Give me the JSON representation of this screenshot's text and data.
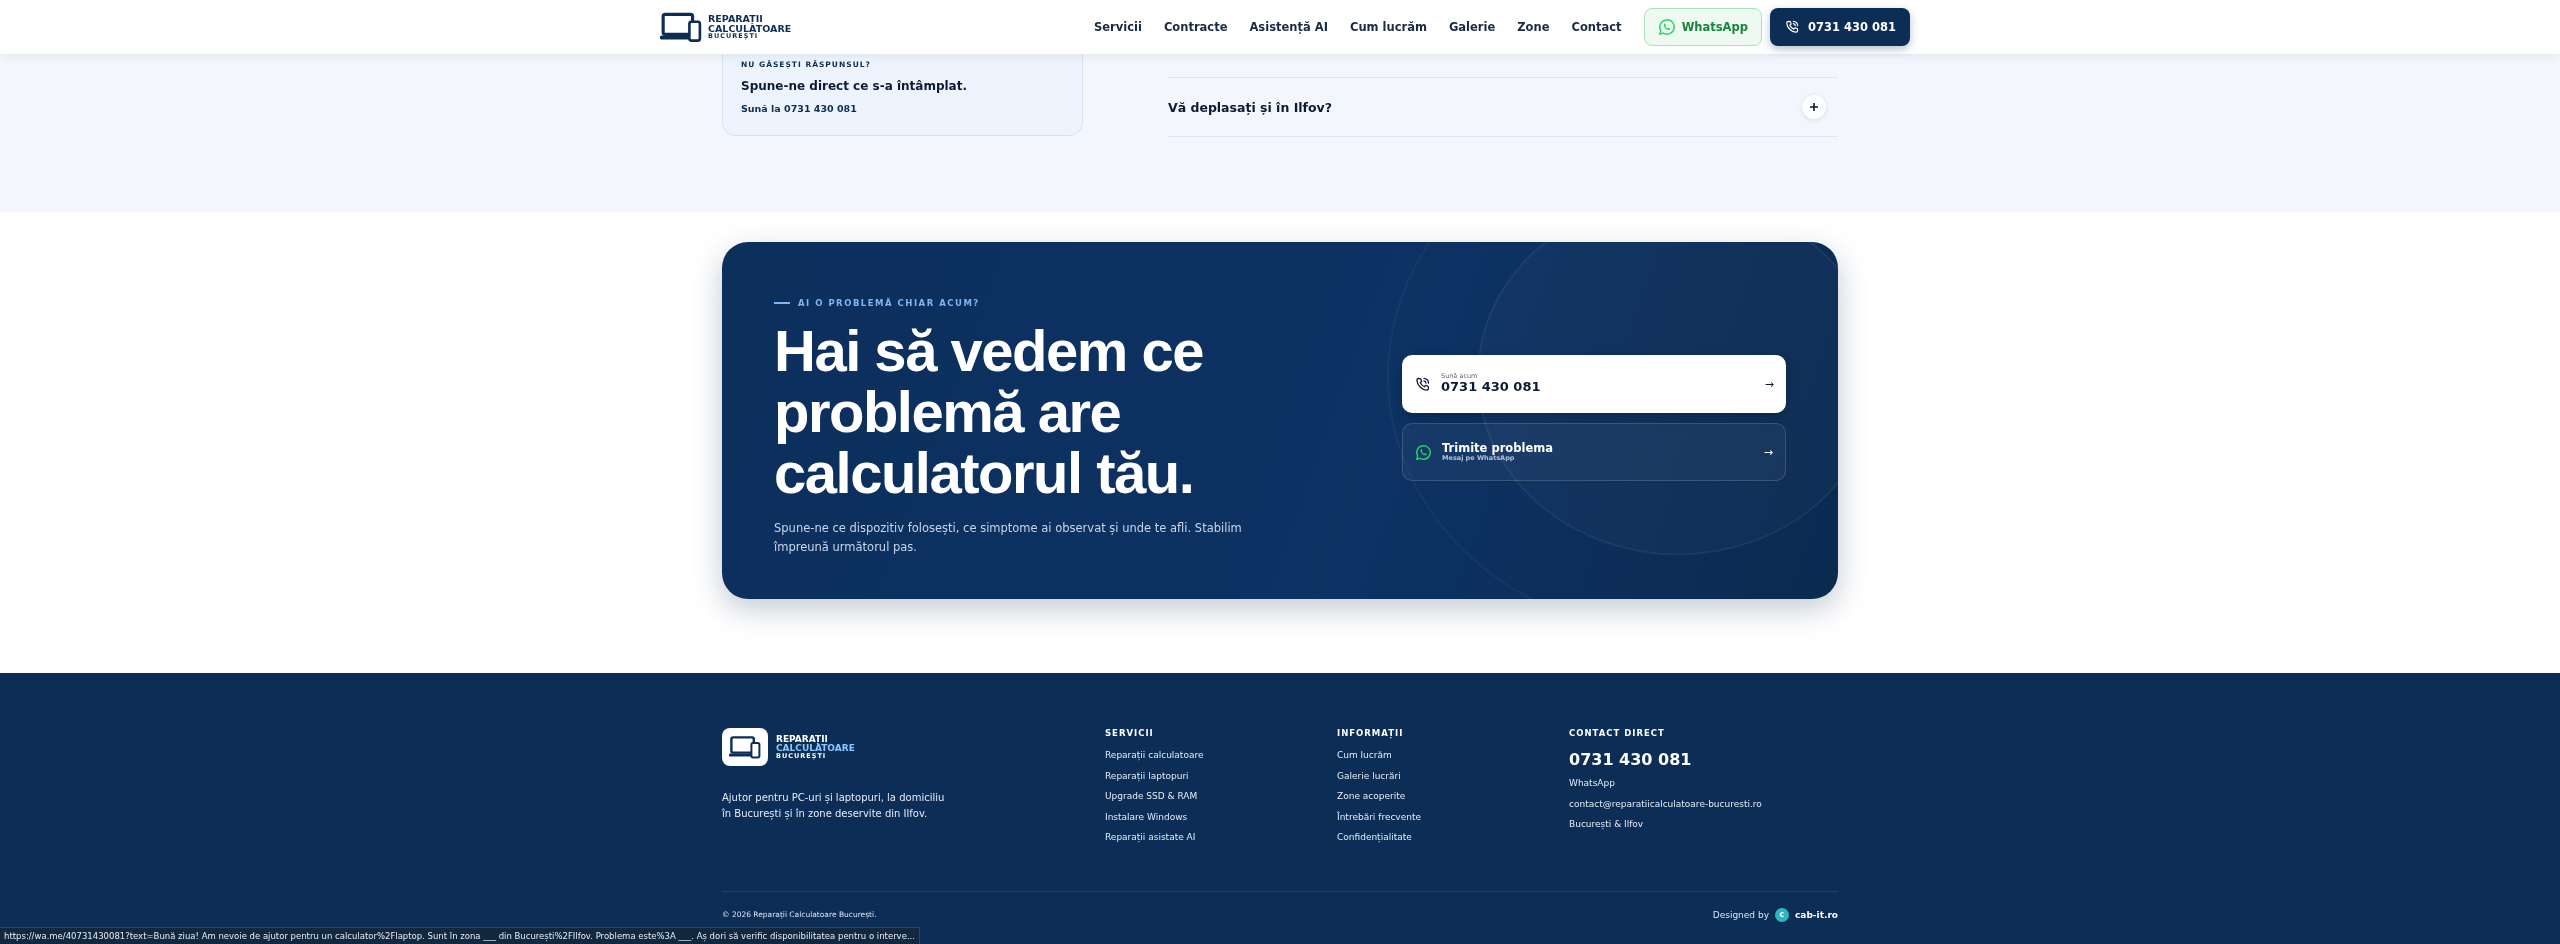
{
  "header": {
    "logo": {
      "line_1": "REPARAȚII",
      "line_2": "CALCULATOARE",
      "line_3": "BUCUREȘTI"
    },
    "nav": [
      {
        "label": "Servicii"
      },
      {
        "label": "Contracte"
      },
      {
        "label": "Asistență AI"
      },
      {
        "label": "Cum lucrăm"
      },
      {
        "label": "Galerie"
      },
      {
        "label": "Zone"
      },
      {
        "label": "Contact"
      }
    ],
    "whatsapp_button": "WhatsApp",
    "phone_button": "0731 430 081"
  },
  "help_card": {
    "eyebrow": "NU GĂSEȘTI RĂSPUNSUL?",
    "title": "Spune-ne direct ce s-a întâmplat.",
    "link": "Sună la 0731 430 081"
  },
  "faq": [
    {
      "question": "Vă deplasați și în Ilfov?",
      "expanded": false
    }
  ],
  "cta": {
    "eyebrow": "AI O PROBLEMĂ CHIAR ACUM?",
    "heading": "Hai să vedem ce\nproblemă are\ncalculatorul tău.",
    "text": "Spune-ne ce dispozitiv folosești, ce simptome ai observat și unde te afli. Stabilim împreună următorul pas.",
    "actions": [
      {
        "kind": "phone",
        "caption": "Sună acum",
        "title": "0731 430 081",
        "arrow": "→"
      },
      {
        "kind": "whatsapp",
        "title": "Trimite problema",
        "caption": "Mesaj pe WhatsApp",
        "arrow": "→"
      }
    ]
  },
  "footer": {
    "logo": {
      "line_1": "REPARAȚII",
      "line_2": "CALCULATOARE",
      "line_3": "BUCUREȘTI"
    },
    "about": "Ajutor pentru PC-uri și laptopuri, la domiciliu în București și în zone deservite din Ilfov.",
    "columns": [
      {
        "title": "SERVICII",
        "links": [
          "Reparații calculatoare",
          "Reparații laptopuri",
          "Upgrade SSD & RAM",
          "Instalare Windows",
          "Reparații asistate AI"
        ]
      },
      {
        "title": "INFORMAȚII",
        "links": [
          "Cum lucrăm",
          "Galerie lucrări",
          "Zone acoperite",
          "Întrebări frecvente",
          "Confidențialitate"
        ]
      },
      {
        "title": "CONTACT DIRECT",
        "phone": "0731 430 081",
        "links": [
          "WhatsApp",
          "contact@reparatiicalculatoare-bucuresti.ro",
          "București & Ilfov"
        ]
      }
    ],
    "copyright": "© 2026 Reparații Calculatoare București.",
    "designed_by": "Designed by",
    "designer_badge": "c",
    "designer": "cab-it.ro"
  },
  "status_bar": "https://wa.me/40731430081?text=Bună ziua! Am nevoie de ajutor pentru un calculator%2Flaptop. Sunt în zona ___ din București%2FIlfov. Problema este%3A ___. Aș dori să verific disponibilitatea pentru o interve..."
}
